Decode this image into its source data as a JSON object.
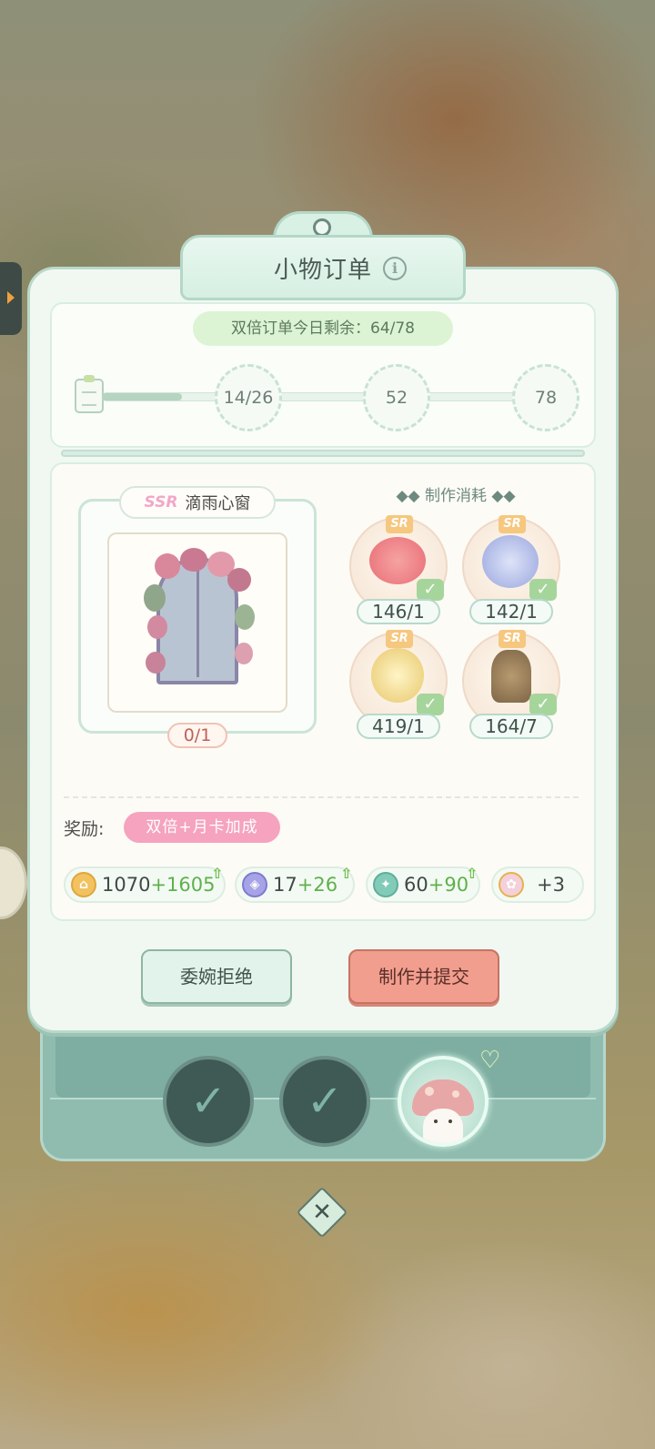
{
  "header": {
    "title": "小物订单"
  },
  "double_order": {
    "text": "双倍订单今日剩余：64/78",
    "remaining": 64,
    "total": 78
  },
  "progress": {
    "fraction": 0.17,
    "milestones": [
      "14/26",
      "52",
      "78"
    ]
  },
  "product": {
    "rarity": "SSR",
    "name": "滴雨心窗",
    "quantity": "0/1"
  },
  "materials": {
    "title": "制作消耗",
    "items": [
      {
        "rarity": "SR",
        "count": "146/1",
        "fulfilled": true
      },
      {
        "rarity": "SR",
        "count": "142/1",
        "fulfilled": true
      },
      {
        "rarity": "SR",
        "count": "419/1",
        "fulfilled": true
      },
      {
        "rarity": "SR",
        "count": "164/7",
        "fulfilled": true
      }
    ]
  },
  "rewards": {
    "label": "奖励:",
    "bonus_tag": "双倍+月卡加成",
    "items": [
      {
        "icon": "coin-icon",
        "base": "1070",
        "bonus": "+1605"
      },
      {
        "icon": "gem-icon",
        "base": "17",
        "bonus": "+26"
      },
      {
        "icon": "exp-icon",
        "base": "60",
        "bonus": "+90"
      },
      {
        "icon": "gift-icon",
        "base": "+3",
        "bonus": ""
      }
    ]
  },
  "buttons": {
    "decline": "委婉拒绝",
    "submit": "制作并提交"
  },
  "order_slots": {
    "completed": 2,
    "active": 1
  },
  "colors": {
    "accent_green": "#5fb14a",
    "submit": "#f29e8e",
    "bonus_pink": "#f5a3bf"
  }
}
